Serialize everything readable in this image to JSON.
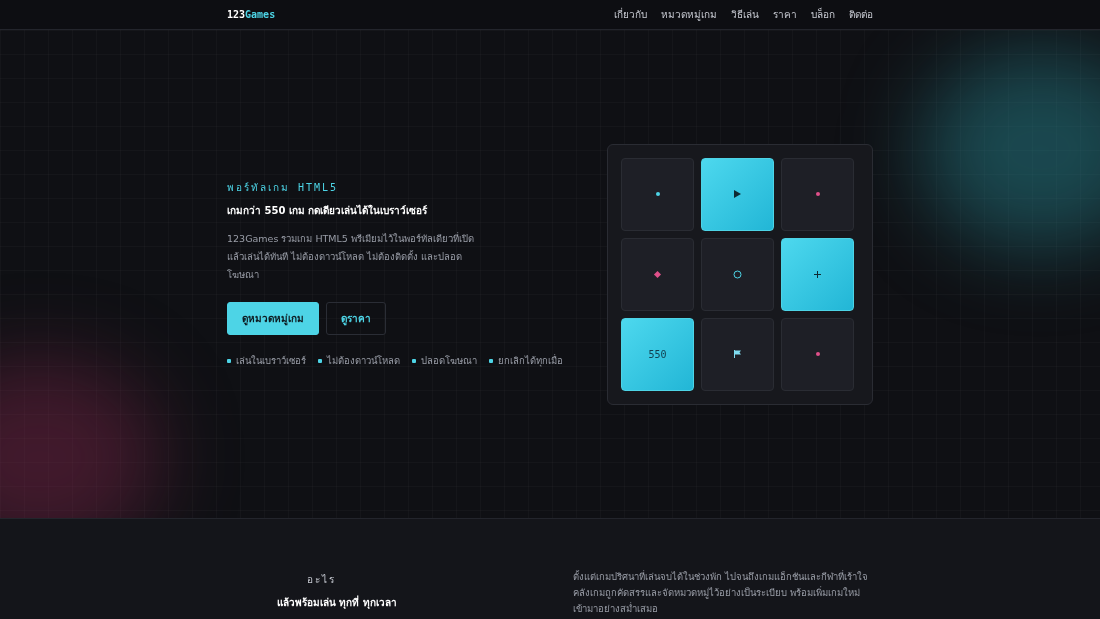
{
  "nav": {
    "logo_a": "123",
    "logo_b": "Games",
    "links": [
      "เกี่ยวกับ",
      "หมวดหมู่เกม",
      "วิธีเล่น",
      "ราคา",
      "บล็อก",
      "ติดต่อ"
    ]
  },
  "hero": {
    "eyebrow": "พอร์ทัลเกม HTML5",
    "headline": "เกมกว่า 550 เกม กดเดียวเล่นได้ในเบราว์เซอร์",
    "body": "123Games รวมเกม HTML5 พรีเมียมไว้ในพอร์ทัลเดียวที่เปิดแล้วเล่นได้ทันที ไม่ต้องดาวน์โหลด ไม่ต้องติดตั้ง และปลอดโฆษณา",
    "buttons": [
      {
        "label": "ดูหมวดหมู่เกม",
        "kind": "primary"
      },
      {
        "label": "ดูราคา",
        "kind": "outline"
      }
    ],
    "features": [
      "เล่นในเบราว์เซอร์",
      "ไม่ต้องดาวน์โหลด",
      "ปลอดโฆษณา",
      "ยกเลิกได้ทุกเมื่อ"
    ]
  },
  "tiles": [
    {
      "highlighted": false,
      "kind": "dot",
      "color": "#4dd4e6"
    },
    {
      "highlighted": true,
      "kind": "play"
    },
    {
      "highlighted": false,
      "kind": "dot",
      "color": "#e0508a"
    },
    {
      "highlighted": false,
      "kind": "diamond",
      "color": "#e0508a"
    },
    {
      "highlighted": false,
      "kind": "ring"
    },
    {
      "highlighted": true,
      "kind": "plus"
    },
    {
      "highlighted": true,
      "kind": "text",
      "text": "550"
    },
    {
      "highlighted": false,
      "kind": "flag"
    },
    {
      "highlighted": false,
      "kind": "dot",
      "color": "#e0508a"
    }
  ],
  "about": {
    "eyebrow": "อะไร",
    "subtitle": "แล้วพร้อมเล่น ทุกที่ ทุกเวลา",
    "body": "ตั้งแต่เกมปริศนาที่เล่นจบได้ในช่วงพัก ไปจนถึงเกมแอ็กชันและกีฬาที่เร้าใจ คลังเกมถูกคัดสรรและจัดหมวดหมู่ไว้อย่างเป็นระเบียบ พร้อมเพิ่มเกมใหม่เข้ามาอย่างสม่ำเสมอ"
  }
}
